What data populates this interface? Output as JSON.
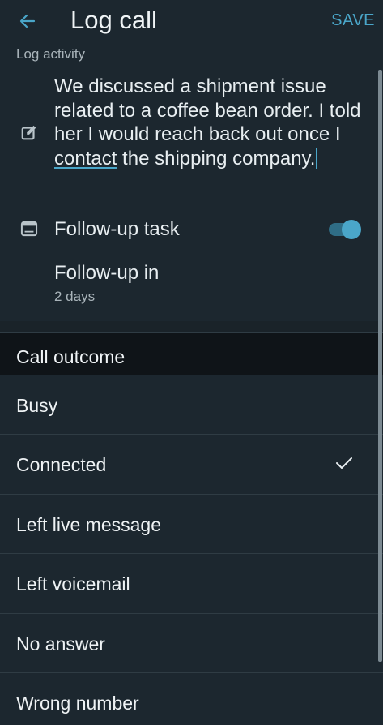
{
  "header": {
    "back_icon": "arrow-left-icon",
    "title": "Log call",
    "save_label": "SAVE"
  },
  "log_activity": {
    "label": "Log activity",
    "note_icon": "edit-note-icon",
    "note_before": "We discussed a shipment issue related to a coffee bean order. I told her I would reach back out once I ",
    "note_link": "contact",
    "note_after": " the shipping company."
  },
  "follow_up": {
    "task_icon": "task-card-icon",
    "task_label": "Follow-up task",
    "task_enabled": true,
    "in_label": "Follow-up in",
    "in_value": "2 days"
  },
  "call_outcome": {
    "title": "Call outcome",
    "options": [
      {
        "label": "Busy",
        "selected": false
      },
      {
        "label": "Connected",
        "selected": true
      },
      {
        "label": "Left live message",
        "selected": false
      },
      {
        "label": "Left voicemail",
        "selected": false
      },
      {
        "label": "No answer",
        "selected": false
      },
      {
        "label": "Wrong number",
        "selected": false
      }
    ]
  },
  "colors": {
    "background": "#1c272f",
    "accent": "#4aa6c9",
    "section_header_bg": "#0f1418"
  }
}
